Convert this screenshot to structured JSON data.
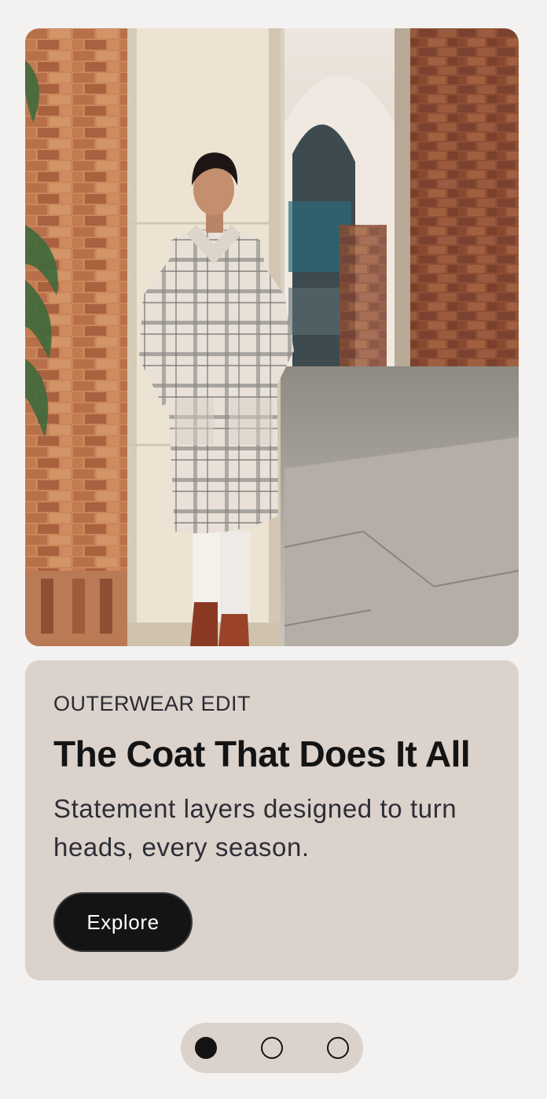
{
  "hero": {
    "image_alt": "Woman in a plaid coat leaning against a column under brick arches"
  },
  "card": {
    "eyebrow": "OUTERWEAR EDIT",
    "headline": "The Coat That Does It All",
    "subtext": "Statement layers designed to turn heads, every season.",
    "cta_label": "Explore"
  },
  "pager": {
    "count": 3,
    "active_index": 0
  },
  "colors": {
    "page_bg": "#f3f2f0",
    "card_bg": "#dbd2cc",
    "button_bg": "#141414",
    "button_text": "#ffffff",
    "text_primary": "#141414"
  }
}
